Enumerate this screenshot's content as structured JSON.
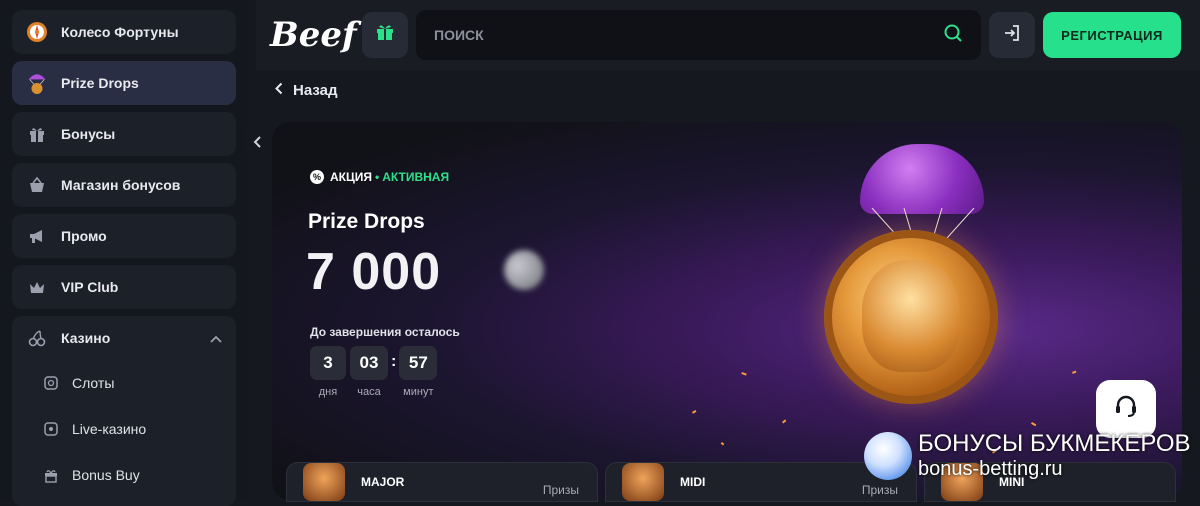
{
  "sidebar": {
    "items": [
      {
        "label": "Колесо Фортуны",
        "icon": "fortune-wheel-icon"
      },
      {
        "label": "Prize Drops",
        "icon": "parachute-coin-icon"
      },
      {
        "label": "Бонусы",
        "icon": "gift-icon"
      },
      {
        "label": "Магазин бонусов",
        "icon": "basket-icon"
      },
      {
        "label": "Промо",
        "icon": "megaphone-icon"
      },
      {
        "label": "VIP Club",
        "icon": "crown-icon"
      }
    ],
    "casino": {
      "label": "Казино",
      "icon": "cherry-icon",
      "sub": [
        {
          "label": "Слоты",
          "icon": "slot-icon"
        },
        {
          "label": "Live-казино",
          "icon": "live-icon"
        },
        {
          "label": "Bonus Buy",
          "icon": "bonus-buy-icon"
        }
      ]
    }
  },
  "header": {
    "logo": "Beef",
    "search_placeholder": "ПОИСК",
    "register_label": "РЕГИСТРАЦИЯ"
  },
  "back_label": "Назад",
  "hero": {
    "badge_label": "АКЦИЯ",
    "badge_status": "АКТИВНАЯ",
    "title": "Prize Drops",
    "amount": "7 000",
    "countdown_label": "До завершения осталось",
    "countdown": [
      {
        "value": "3",
        "unit": "дня"
      },
      {
        "value": "03",
        "unit": "часа"
      },
      {
        "value": "57",
        "unit": "минут"
      }
    ]
  },
  "cards": [
    {
      "title": "MAJOR",
      "prize_label": "Призы"
    },
    {
      "title": "MIDI",
      "prize_label": "Призы"
    },
    {
      "title": "MINI",
      "prize_label": ""
    }
  ],
  "watermark": {
    "line1": "БОНУСЫ БУКМЕКЕРОВ",
    "line2": "bonus-betting.ru"
  },
  "colors": {
    "accent": "#27e08c",
    "background": "#15181f",
    "hero_purple": "#5a2a8a"
  }
}
